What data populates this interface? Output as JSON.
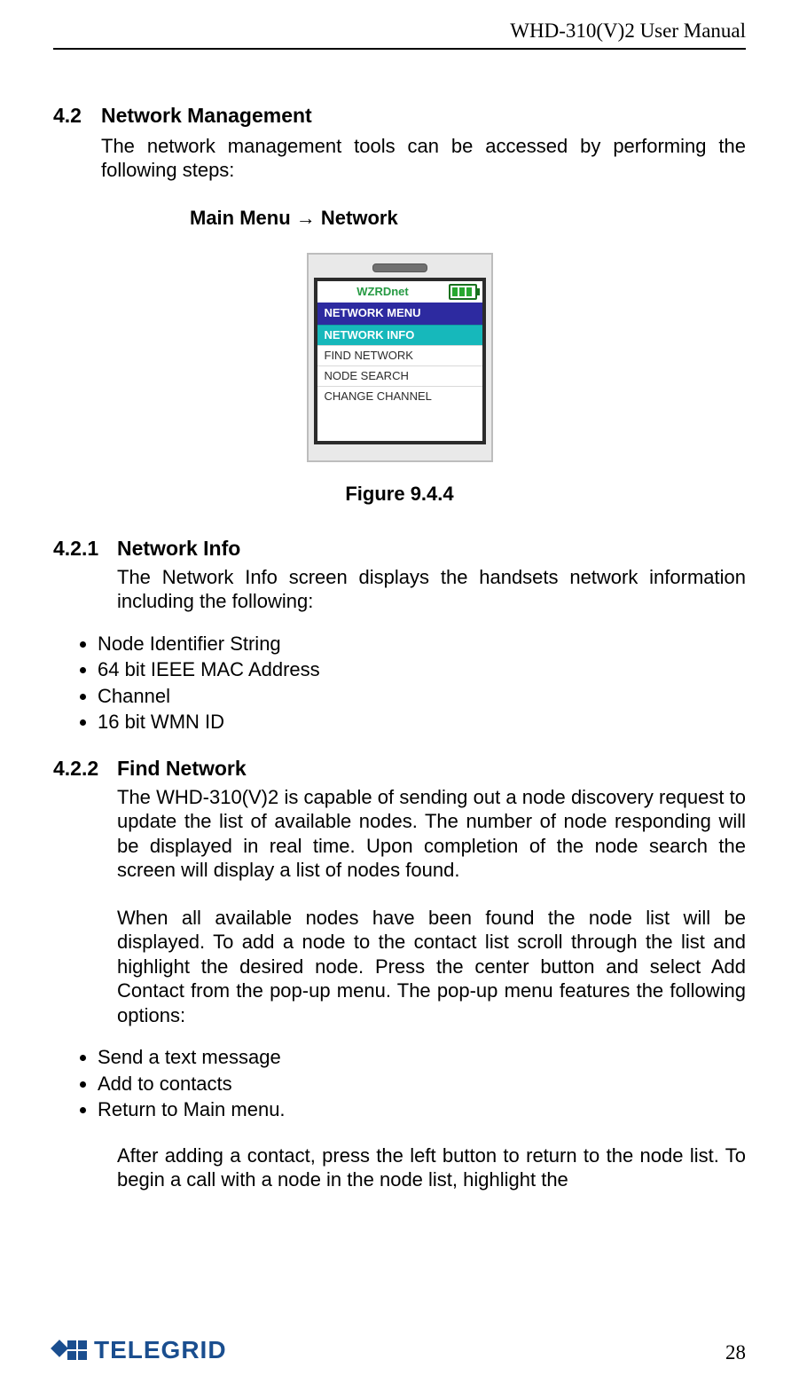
{
  "header": {
    "doc_title": "WHD-310(V)2 User Manual"
  },
  "section_4_2": {
    "number": "4.2",
    "title": "Network Management",
    "intro": "The network management tools can be accessed by performing the following steps:",
    "breadcrumb": "Main Menu → Network"
  },
  "figure_9_4_4": {
    "caption": "Figure 9.4.4",
    "device": {
      "brand": "WZRDnet",
      "menu_title": "NETWORK MENU",
      "items": [
        {
          "label": "NETWORK INFO",
          "selected": true
        },
        {
          "label": "FIND NETWORK",
          "selected": false
        },
        {
          "label": "NODE SEARCH",
          "selected": false
        },
        {
          "label": "CHANGE CHANNEL",
          "selected": false
        }
      ]
    }
  },
  "section_4_2_1": {
    "number": "4.2.1",
    "title": "Network Info",
    "intro": "The Network Info screen displays the handsets network information including the following:",
    "bullets": [
      "Node Identifier String",
      "64 bit IEEE MAC Address",
      "Channel",
      "16 bit WMN ID"
    ]
  },
  "section_4_2_2": {
    "number": "4.2.2",
    "title": "Find Network",
    "para1": "The WHD-310(V)2 is capable of sending out a node discovery request to update the list of available nodes.  The number of node responding will be displayed in real time.  Upon completion of the node search the screen will display a list of nodes found.",
    "para2": "When all available nodes have been found the node list will be displayed.  To add a node to the contact list scroll through the list and highlight the desired node.  Press the center button and select Add Contact from the pop-up menu.  The pop-up menu features the following options:",
    "bullets": [
      "Send a text message",
      "Add to contacts",
      "Return to Main menu."
    ],
    "para3": "After adding a contact, press the left button to return to the node list.  To begin a call with a node in the node list, highlight the"
  },
  "footer": {
    "logo_text": "TELEGRID",
    "page_number": "28"
  }
}
